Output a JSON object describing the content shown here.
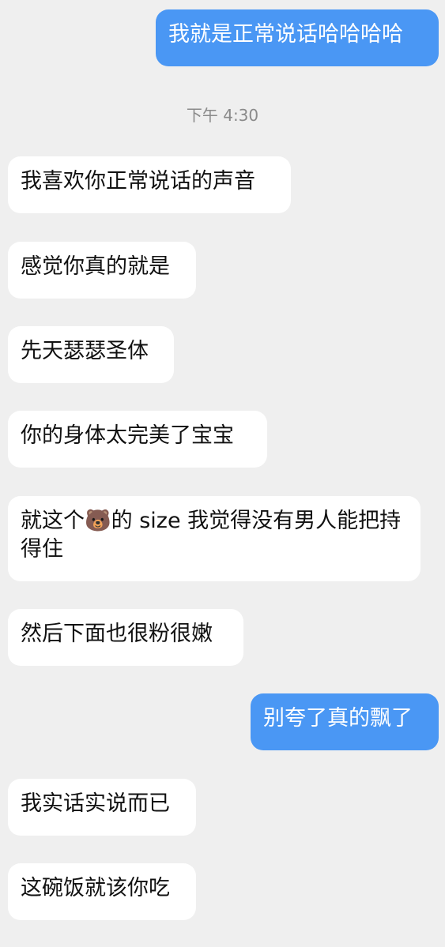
{
  "messages": [
    {
      "text": "我就是正常说话哈哈哈哈",
      "from": "me"
    },
    {
      "text": "我喜欢你正常说话的声音",
      "from": "them"
    },
    {
      "text": "感觉你真的就是",
      "from": "them"
    },
    {
      "text": "先天瑟瑟圣体",
      "from": "them"
    },
    {
      "text": "你的身体太完美了宝宝",
      "from": "them"
    },
    {
      "text": "就这个🐻的 size 我觉得没有男人能把持得住",
      "from": "them"
    },
    {
      "text": "然后下面也很粉很嫩",
      "from": "them"
    },
    {
      "text": "别夸了真的飘了",
      "from": "me"
    },
    {
      "text": "我实话实说而已",
      "from": "them"
    },
    {
      "text": "这碗饭就该你吃",
      "from": "them"
    }
  ],
  "timestamp": "下午 4:30",
  "colors": {
    "background": "#efefef",
    "outgoing_bubble": "#4a97f4",
    "incoming_bubble": "#ffffff"
  }
}
